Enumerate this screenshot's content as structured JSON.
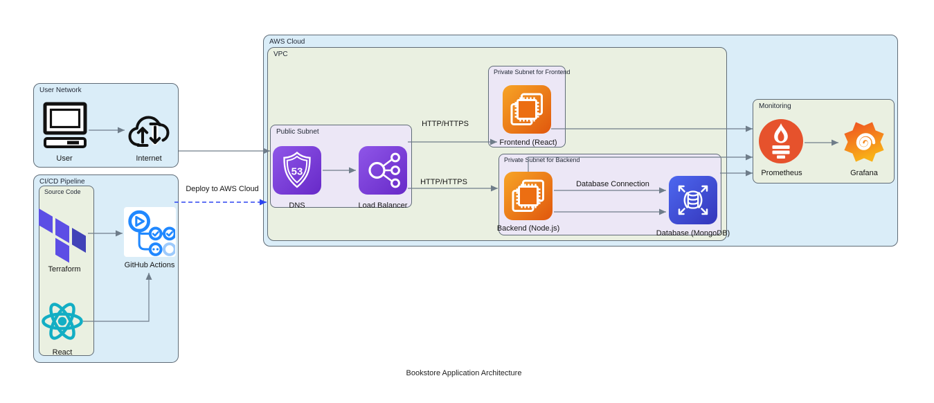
{
  "title": "Bookstore Application Architecture",
  "groups": {
    "user_network": {
      "label": "User Network"
    },
    "cicd": {
      "label": "CI/CD Pipeline"
    },
    "source_code": {
      "label": "Source Code"
    },
    "aws_cloud": {
      "label": "AWS Cloud"
    },
    "vpc": {
      "label": "VPC"
    },
    "public_subnet": {
      "label": "Public Subnet"
    },
    "frontend_subnet": {
      "label": "Private Subnet for Frontend"
    },
    "backend_subnet": {
      "label": "Private Subnet for Backend"
    },
    "monitoring": {
      "label": "Monitoring"
    }
  },
  "nodes": {
    "user": {
      "label": "User"
    },
    "internet": {
      "label": "Internet"
    },
    "terraform": {
      "label": "Terraform"
    },
    "react": {
      "label": "React"
    },
    "github_actions": {
      "label": "GitHub Actions"
    },
    "dns": {
      "label": "DNS",
      "badge": "53"
    },
    "load_balancer": {
      "label": "Load Balancer"
    },
    "frontend": {
      "label": "Frontend (React)"
    },
    "backend": {
      "label": "Backend (Node.js)"
    },
    "database": {
      "label": "Database (MongoDB)"
    },
    "prometheus": {
      "label": "Prometheus"
    },
    "grafana": {
      "label": "Grafana"
    }
  },
  "edges": {
    "deploy": {
      "label": "Deploy to AWS Cloud"
    },
    "lb_to_frontend": {
      "label": "HTTP/HTTPS"
    },
    "lb_to_backend": {
      "label": "HTTP/HTTPS"
    },
    "backend_to_database": {
      "label": "Database Connection"
    }
  },
  "colors": {
    "edge_gray": "#6f7d8a",
    "deploy_arrow_blue": "#2b44f0",
    "box_blue": "#daedf8",
    "box_green": "#eaf0e1",
    "box_lavender": "#ece7f6",
    "aws_purple": "#8f56e8",
    "aws_orange": "#e8630c",
    "aws_db_blue": "#4d68f0",
    "prometheus_red": "#e6522c",
    "grafana_orange": "#f05a28",
    "react_teal": "#13aec4",
    "terraform_purple": "#5c4ee5",
    "github_blue": "#2088ff"
  }
}
